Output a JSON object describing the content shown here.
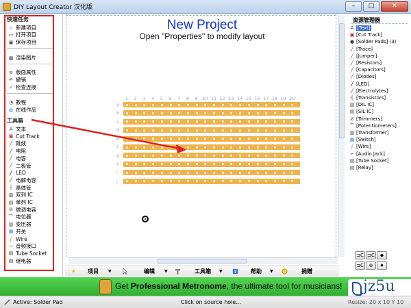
{
  "window": {
    "title": "DIY Layout Creator 汉化版",
    "minimize": "–",
    "maximize": "□",
    "close": "✕"
  },
  "left": {
    "quick_title": "快速任务",
    "quick": [
      {
        "label": "新建项目",
        "icon": "new-file-icon"
      },
      {
        "label": "打开项目",
        "icon": "open-folder-icon"
      },
      {
        "label": "保存项目",
        "icon": "save-icon"
      },
      {
        "label": "渲染图片",
        "icon": "image-icon"
      },
      {
        "label": "版面属性",
        "icon": "properties-icon"
      },
      {
        "label": "撤销",
        "icon": "undo-icon"
      },
      {
        "label": "检查连接",
        "icon": "check-connection-icon"
      },
      {
        "label": "教程",
        "icon": "tutorial-icon"
      },
      {
        "label": "在线作品",
        "icon": "globe-icon"
      }
    ],
    "toolbox_title": "工具箱",
    "toolbox": [
      {
        "label": "文本",
        "icon": "text-icon"
      },
      {
        "label": "Cut Track",
        "icon": "cut-track-icon"
      },
      {
        "label": "跳线",
        "icon": "jumper-icon"
      },
      {
        "label": "电阻",
        "icon": "resistor-icon"
      },
      {
        "label": "电容",
        "icon": "capacitor-icon"
      },
      {
        "label": "二极管",
        "icon": "diode-icon"
      },
      {
        "label": "LED",
        "icon": "led-icon"
      },
      {
        "label": "电解电容",
        "icon": "electrolytic-icon"
      },
      {
        "label": "晶体管",
        "icon": "transistor-icon"
      },
      {
        "label": "双列 IC",
        "icon": "dil-ic-icon"
      },
      {
        "label": "单列 IC",
        "icon": "sil-ic-icon"
      },
      {
        "label": "微调电容",
        "icon": "trimmer-icon"
      },
      {
        "label": "电位器",
        "icon": "potentiometer-icon"
      },
      {
        "label": "变压器",
        "icon": "transformer-icon"
      },
      {
        "label": "开关",
        "icon": "switch-icon"
      },
      {
        "label": "Wire",
        "icon": "wire-icon"
      },
      {
        "label": "音频接口",
        "icon": "audio-jack-icon"
      },
      {
        "label": "Tube Socket",
        "icon": "tube-socket-icon"
      },
      {
        "label": "继电器",
        "icon": "relay-icon"
      }
    ]
  },
  "canvas": {
    "title": "New Project",
    "subtitle": "Open \"Properties\" to modify layout",
    "col_numbers": [
      "1",
      "2",
      "3",
      "4",
      "5",
      "6",
      "7",
      "8",
      "9",
      "10",
      "11",
      "12",
      "13",
      "14",
      "15",
      "16",
      "17",
      "18",
      "19",
      "20"
    ],
    "row_letters": [
      "a",
      "b",
      "c",
      "d",
      "e",
      "f",
      "g",
      "h",
      "i",
      "j"
    ]
  },
  "bottom_toolbar": {
    "project": "项目",
    "edit": "编辑",
    "toolbox": "工具箱",
    "help": "帮助",
    "donate": "捐赠"
  },
  "right": {
    "title": "资源管理器",
    "items": [
      {
        "label": "[Text]",
        "icon": "text-icon",
        "selected": true
      },
      {
        "label": "[Cut Track]",
        "icon": "cut-track-icon",
        "selected": false
      },
      {
        "label": "[Solder Pads] (3)",
        "icon": "solder-pad-icon",
        "selected": false
      },
      {
        "label": "[Trace]",
        "icon": "trace-icon",
        "selected": false
      },
      {
        "label": "[Jumper]",
        "icon": "jumper-icon",
        "selected": false
      },
      {
        "label": "[Resistors]",
        "icon": "resistor-icon",
        "selected": false
      },
      {
        "label": "[Capacitors]",
        "icon": "capacitor-icon",
        "selected": false
      },
      {
        "label": "[Diodes]",
        "icon": "diode-icon",
        "selected": false
      },
      {
        "label": "[LED]",
        "icon": "led-icon",
        "selected": false
      },
      {
        "label": "[Electrolytes]",
        "icon": "electrolytic-icon",
        "selected": false
      },
      {
        "label": "[Transistors]",
        "icon": "transistor-icon",
        "selected": false
      },
      {
        "label": "[DIL IC]",
        "icon": "dil-ic-icon",
        "selected": false
      },
      {
        "label": "[SIL IC]",
        "icon": "sil-ic-icon",
        "selected": false
      },
      {
        "label": "[Trimmers]",
        "icon": "trimmer-icon",
        "selected": false
      },
      {
        "label": "[Potentiometers]",
        "icon": "potentiometer-icon",
        "selected": false
      },
      {
        "label": "[Transformer]",
        "icon": "transformer-icon",
        "selected": false
      },
      {
        "label": "[Switch]",
        "icon": "switch-icon",
        "selected": false
      },
      {
        "label": "[Wire]",
        "icon": "wire-icon",
        "selected": false
      },
      {
        "label": "[Audio Jack]",
        "icon": "audio-jack-icon",
        "selected": false
      },
      {
        "label": "[Tube Socket]",
        "icon": "tube-socket-icon",
        "selected": false
      },
      {
        "label": "[Relay]",
        "icon": "relay-icon",
        "selected": false
      }
    ],
    "buttons": [
      "⊐C",
      "⊐C",
      "◆",
      "⊐C",
      "⊕",
      "♦"
    ]
  },
  "banner": {
    "pre": "Get ",
    "brand": "Professional Metronome",
    "post": ", the ultimate tool for musicians!"
  },
  "watermark": "jz5u",
  "status": {
    "active": "Active: Solder Pad",
    "hint": "Click on source hole...",
    "coords": "Resize: 20 x 10 Y 10"
  },
  "colors": {
    "board": "#f0b34c",
    "title_blue": "#1533d6",
    "banner_green": "#3dbd3d",
    "annotation_red": "#e02020",
    "selection_blue": "#3a6bd1"
  }
}
